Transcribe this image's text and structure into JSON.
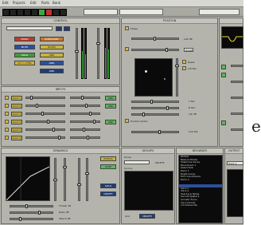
{
  "menu": [
    "Edit",
    "Projects",
    "Edit",
    "Parts",
    "Bank"
  ],
  "toolbar": {
    "field1": "",
    "field2": "",
    "field3": ""
  },
  "panels": {
    "control": {
      "title": "CONTROL",
      "preset": "",
      "buttons": [
        "MONO",
        "SURROUND",
        "MUTE",
        "ROOM",
        "SOLO",
        "LINK",
        "CH -> CTRL",
        "LINK",
        "LINK"
      ],
      "meter_labels": [
        "",
        ""
      ]
    },
    "position": {
      "title": "POSITION",
      "phase_label": "Phase",
      "right_labels": [
        "Left dB",
        "Rotate",
        "Reset",
        "L/R Pan",
        "F Pan",
        "B Pan",
        "L/R dB",
        "Width"
      ],
      "double_center_label": "Double Center",
      "bottom_label": "Sub Pan"
    },
    "ext": {
      "title": "",
      "side_labels": [
        "",
        "",
        ""
      ]
    },
    "input_section": {
      "title": "INPUTS",
      "rows": [
        "Input 1",
        "Input 2",
        "Input 3",
        "Input 4",
        "Input 5",
        "Input 6"
      ],
      "right_buttons": [
        "LINK",
        "LINK",
        "LINK"
      ]
    },
    "dynamics": {
      "title": "DYNAMICS",
      "buttons": [
        "BYPASS",
        "GATE",
        "SOLO",
        "ON/OFF"
      ],
      "bottom_labels": [
        "Thresh dB",
        "Ratio dB",
        "Attack dB"
      ]
    },
    "groups": {
      "title": "GROUPS",
      "label1": "Group",
      "label2": "Source",
      "delete_label": "DELETE",
      "add_label": "Add"
    },
    "browser": {
      "title": "BROWSER",
      "list": [
        "Pk/Stat",
        "Balance Modes",
        "Telephone Voices",
        "Move Room 1",
        "Gated Verb",
        "Room 1",
        "Bright Voices",
        "Echo Countdowns",
        "Room 2",
        "",
        "",
        "Voice 1",
        "Voice 2",
        "Hearing & Media",
        "Sounds Spatial 2",
        "Acoustic Focus",
        "Voice Format",
        "1/3 Octave Mix"
      ],
      "selected": 10
    },
    "output": {
      "title": "OUTPUT",
      "field": "Track 1"
    }
  }
}
